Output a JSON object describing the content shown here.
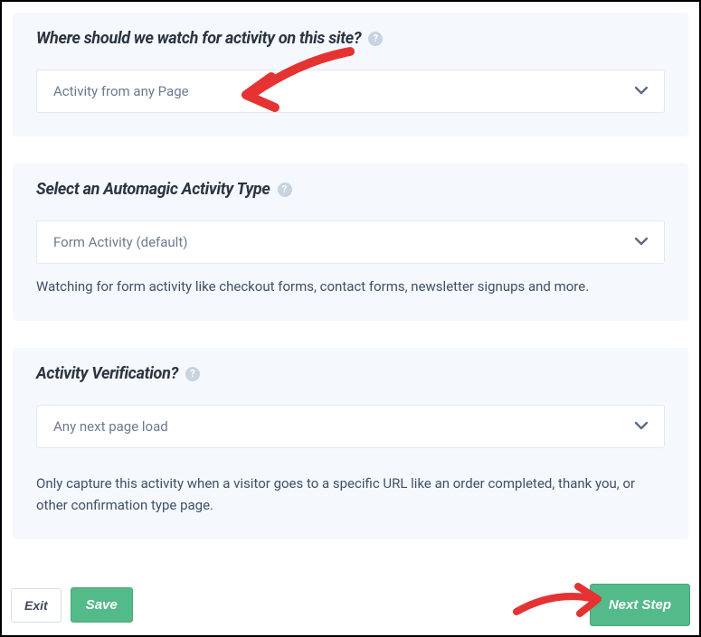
{
  "sections": {
    "watch": {
      "title": "Where should we watch for activity on this site?",
      "select": "Activity from any Page"
    },
    "type": {
      "title": "Select an Automagic Activity Type",
      "select": "Form Activity (default)",
      "helper": "Watching for form activity like checkout forms, contact forms, newsletter signups and more."
    },
    "verify": {
      "title": "Activity Verification?",
      "select": "Any next page load",
      "helper": "Only capture this activity when a visitor goes to a specific URL like an order completed, thank you, or other confirmation type page."
    }
  },
  "buttons": {
    "exit": "Exit",
    "save": "Save",
    "next": "Next Step"
  },
  "help_glyph": "?"
}
